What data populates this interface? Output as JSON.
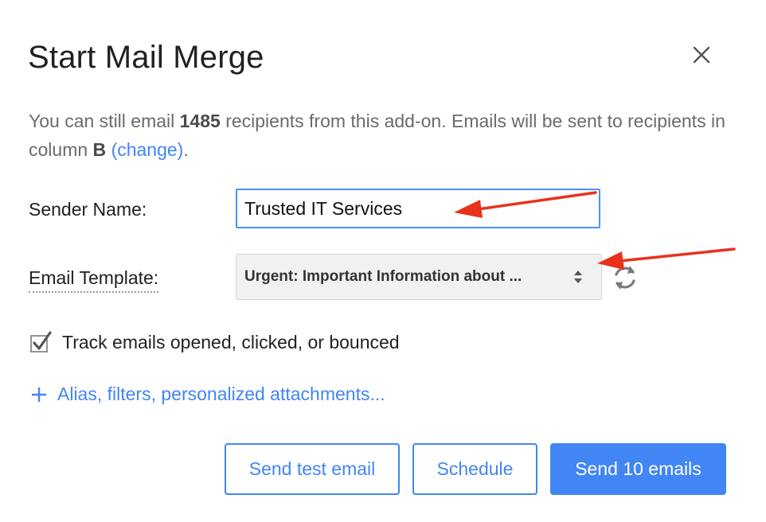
{
  "dialog": {
    "title": "Start Mail Merge",
    "close_icon": "close-icon"
  },
  "intro": {
    "part1": "You can still email ",
    "count": "1485",
    "part2": " recipients from this add-on. Emails will be sent to recipients in column ",
    "column": "B",
    "space": " ",
    "change_link": "(change)",
    "period": "."
  },
  "form": {
    "sender_label": "Sender Name:",
    "sender_value": "Trusted IT Services",
    "template_label": "Email Template:",
    "template_value": "Urgent: Important Information about ...",
    "refresh_icon": "refresh-icon",
    "track_checked": true,
    "track_label": "Track emails opened, clicked, or bounced",
    "more_link": "Alias, filters, personalized attachments..."
  },
  "buttons": {
    "test": "Send test email",
    "schedule": "Schedule",
    "send": "Send 10 emails"
  },
  "colors": {
    "accent": "#4285f4",
    "annotation_arrow": "#e8321c"
  }
}
